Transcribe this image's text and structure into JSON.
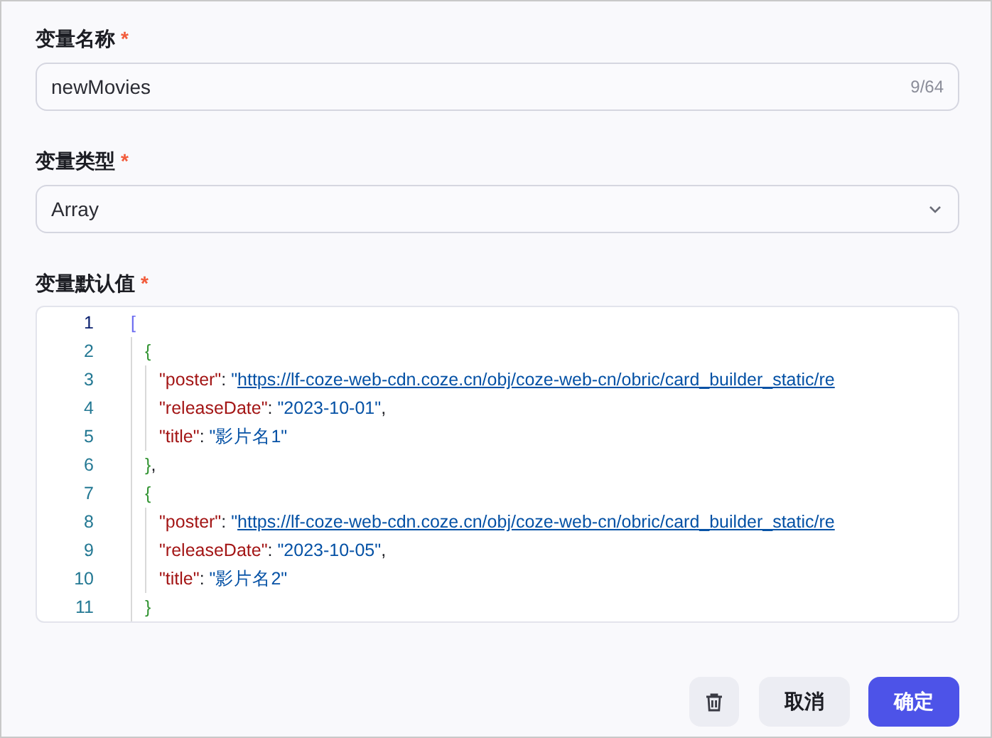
{
  "fields": [
    {
      "kind": "input",
      "label": "变量名称",
      "required_mark": "*",
      "value": "newMovies",
      "counter": "9/64"
    },
    {
      "kind": "select",
      "label": "变量类型",
      "required_mark": "*",
      "value": "Array"
    },
    {
      "kind": "code",
      "label": "变量默认值",
      "required_mark": "*",
      "lines": [
        {
          "number": "1",
          "tokens": [
            {
              "kind": "punct",
              "text": "["
            }
          ]
        },
        {
          "number": "2",
          "tokens": [
            {
              "kind": "punct",
              "text": "{"
            }
          ]
        },
        {
          "number": "3",
          "tokens": [
            {
              "kind": "key",
              "text": "\"poster\""
            },
            {
              "kind": "plain",
              "text": ": "
            },
            {
              "kind": "string",
              "text": "\""
            },
            {
              "kind": "link",
              "text": "https://lf-coze-web-cdn.coze.cn/obj/coze-web-cn/obric/card_builder_static/re"
            }
          ]
        },
        {
          "number": "4",
          "tokens": [
            {
              "kind": "key",
              "text": "\"releaseDate\""
            },
            {
              "kind": "plain",
              "text": ": "
            },
            {
              "kind": "string",
              "text": "\"2023-10-01\""
            },
            {
              "kind": "plain",
              "text": ","
            }
          ]
        },
        {
          "number": "5",
          "tokens": [
            {
              "kind": "key",
              "text": "\"title\""
            },
            {
              "kind": "plain",
              "text": ": "
            },
            {
              "kind": "string",
              "text": "\"影片名1\""
            }
          ]
        },
        {
          "number": "6",
          "tokens": [
            {
              "kind": "punct",
              "text": "}"
            },
            {
              "kind": "plain",
              "text": ","
            }
          ]
        },
        {
          "number": "7",
          "tokens": [
            {
              "kind": "punct",
              "text": "{"
            }
          ]
        },
        {
          "number": "8",
          "tokens": [
            {
              "kind": "key",
              "text": "\"poster\""
            },
            {
              "kind": "plain",
              "text": ": "
            },
            {
              "kind": "string",
              "text": "\""
            },
            {
              "kind": "link",
              "text": "https://lf-coze-web-cdn.coze.cn/obj/coze-web-cn/obric/card_builder_static/re"
            }
          ]
        },
        {
          "number": "9",
          "tokens": [
            {
              "kind": "key",
              "text": "\"releaseDate\""
            },
            {
              "kind": "plain",
              "text": ": "
            },
            {
              "kind": "string",
              "text": "\"2023-10-05\""
            },
            {
              "kind": "plain",
              "text": ","
            }
          ]
        },
        {
          "number": "10",
          "tokens": [
            {
              "kind": "key",
              "text": "\"title\""
            },
            {
              "kind": "plain",
              "text": ": "
            },
            {
              "kind": "string",
              "text": "\"影片名2\""
            }
          ]
        },
        {
          "number": "11",
          "tokens": [
            {
              "kind": "punct",
              "text": "}"
            }
          ]
        }
      ]
    }
  ],
  "buttons": [
    {
      "kind": "delete"
    },
    {
      "kind": "secondary",
      "label": "取消"
    },
    {
      "kind": "primary",
      "label": "确定"
    }
  ]
}
